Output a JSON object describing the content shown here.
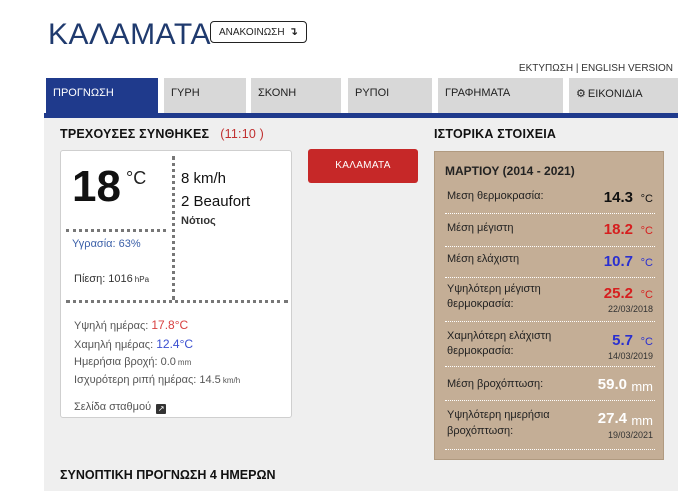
{
  "header": {
    "title": "ΚΑΛΑΜΑΤΑ",
    "announce_label": "ΑΝΑΚΟΙΝΩΣΗ",
    "announce_arrow": "↴"
  },
  "toplinks": {
    "print": "ΕΚΤΥΠΩΣΗ",
    "separator": "|",
    "english": "ENGLISH VERSION"
  },
  "tabs": [
    {
      "label": "ΠΡΟΓΝΩΣΗ",
      "active": true
    },
    {
      "label": "ΓΥΡΗ"
    },
    {
      "label": "ΣΚΟΝΗ"
    },
    {
      "label": "ΡΥΠΟΙ"
    },
    {
      "label": "ΓΡΑΦΗΜΑΤΑ"
    },
    {
      "label": "ΕΙΚΟΝΙΔΙΑ",
      "icon": "gear-icon"
    }
  ],
  "current": {
    "title": "ΤΡΕΧΟΥΣΕΣ ΣΥΝΘΗΚΕΣ",
    "time": "(11:10 )",
    "temperature": "18",
    "temp_unit": "°C",
    "humidity": "Υγρασία: 63%",
    "pressure_label": "Πίεση: 1016",
    "pressure_unit": "hPa",
    "wind_speed": "8 km/h",
    "wind_beaufort": "2 Beaufort",
    "wind_direction": "Νότιος",
    "high_label": "Υψηλή ημέρας:",
    "high_value": "17.8°C",
    "low_label": "Χαμηλή ημέρας:",
    "low_value": "12.4°C",
    "rain_label": "Ημερήσια βροχή: 0.0",
    "rain_unit": "mm",
    "gust_label": "Ισχυρότερη ριπή ημέρας: 14.5",
    "gust_unit": "km/h",
    "station_link": "Σελίδα σταθμού"
  },
  "city_button": "ΚΑΛΑΜΑΤΑ",
  "history": {
    "title": "ΙΣΤΟΡΙΚΑ ΣΤΟΙΧΕΙΑ",
    "period": "ΜΑΡΤΙΟΥ (2014 - 2021)",
    "rows": [
      {
        "label": "Μεση θερμοκρασία:",
        "value": "14.3",
        "unit": "°C",
        "color": "#111111"
      },
      {
        "label": "Μέση μέγιστη",
        "value": "18.2",
        "unit": "°C",
        "color": "#d61e1e"
      },
      {
        "label": "Μέση ελάχιστη",
        "value": "10.7",
        "unit": "°C",
        "color": "#2a2fd0"
      },
      {
        "label1": "Υψηλότερη μέγιστη",
        "label2": "θερμοκρασία:",
        "value": "25.2",
        "unit": "°C",
        "date": "22/03/2018",
        "color": "#d61e1e"
      },
      {
        "label1": "Χαμηλότερη ελάχιστη",
        "label2": "θερμοκρασία:",
        "value": "5.7",
        "unit": "°C",
        "date": "14/03/2019",
        "color": "#2a2fd0"
      },
      {
        "label": "Μέση βροχόπτωση:",
        "value": "59.0",
        "unit": "mm",
        "color": "#ffffff"
      },
      {
        "label1": "Υψηλότερη ημερήσια",
        "label2": "βροχόπτωση:",
        "value": "27.4",
        "unit": "mm",
        "date": "19/03/2021",
        "color": "#ffffff"
      }
    ]
  },
  "forecast": {
    "title": "ΣΥΝΟΠΤΙΚΗ ΠΡΟΓΝΩΣΗ 4 ΗΜΕΡΩΝ"
  }
}
